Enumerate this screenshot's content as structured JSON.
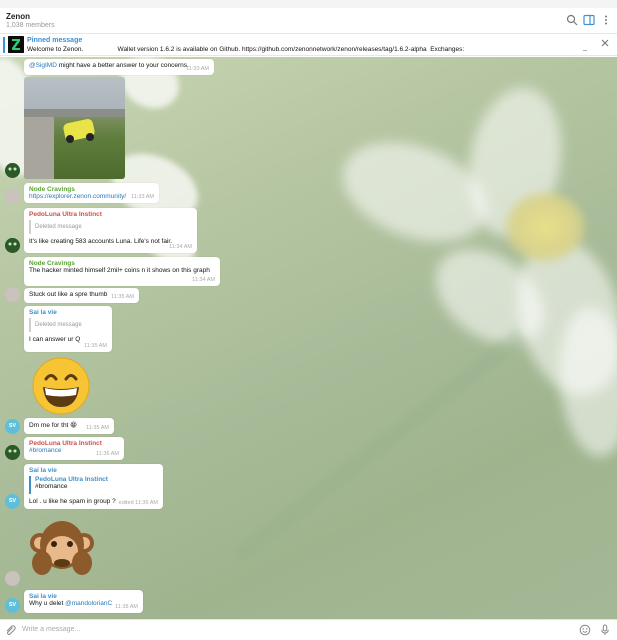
{
  "header": {
    "title": "Zenon",
    "members": "1,038 members"
  },
  "pinned": {
    "label": "Pinned message",
    "text": "Welcome to Zenon.                   Wallet version 1.6.2 is available on Github. https://github.com/zenonnetwork/zenon/releases/tag/1.6.2-alpha  Exchanges:",
    "collapse": "_"
  },
  "messages": {
    "m1": {
      "mention": "@SigIMD",
      "text": " might have a better answer to your concerns.",
      "time": "11:33 AM"
    },
    "m2": {
      "name": "Node Cravings",
      "link": "https://explorer.zenon.community/",
      "time": "11:33 AM"
    },
    "m3": {
      "name": "PedoLuna Ultra Instinct",
      "reply": "Deleted message",
      "text": "It's like creating 583 accounts Luna. Life's not fair.",
      "time": "11:34 AM"
    },
    "m4": {
      "name": "Node Cravings",
      "text": "The hacker minted himself 2mil+ coins n it shows on this graph",
      "time": "11:34 AM"
    },
    "m5": {
      "text": "Stuck out like a spre thumb",
      "time": "11:35 AM"
    },
    "m6": {
      "name": "Sai la vie",
      "reply": "Deleted message",
      "text": "I can answer ur Q",
      "time": "11:35 AM"
    },
    "m7": {
      "text": "Dm me for tht 😁",
      "time": "11:35 AM"
    },
    "m8": {
      "name": "PedoLuna Ultra Instinct",
      "text": "#bromance",
      "time": "11:36 AM"
    },
    "m9": {
      "name": "Sai la vie",
      "reply_name": "PedoLuna Ultra Instinct",
      "reply_text": "#bromance",
      "text": "Lol . u like he spam in group ?",
      "time": "edited 11:36 AM"
    },
    "m10": {
      "name": "Sai la vie",
      "text": "Why u delet ",
      "mention": "@mandolorianC",
      "time": "11:38 AM"
    }
  },
  "avatars": {
    "sv": "SV"
  },
  "composer": {
    "placeholder": "Write a message..."
  },
  "colors": {
    "accent": "#3e93d5",
    "green_name": "#5aa332",
    "red_name": "#cc5049",
    "blue_name": "#3e8fc9"
  },
  "icons": [
    "search-icon",
    "sidebar-toggle-icon",
    "more-vertical-icon",
    "close-icon",
    "attach-icon",
    "emoji-icon",
    "microphone-icon"
  ]
}
